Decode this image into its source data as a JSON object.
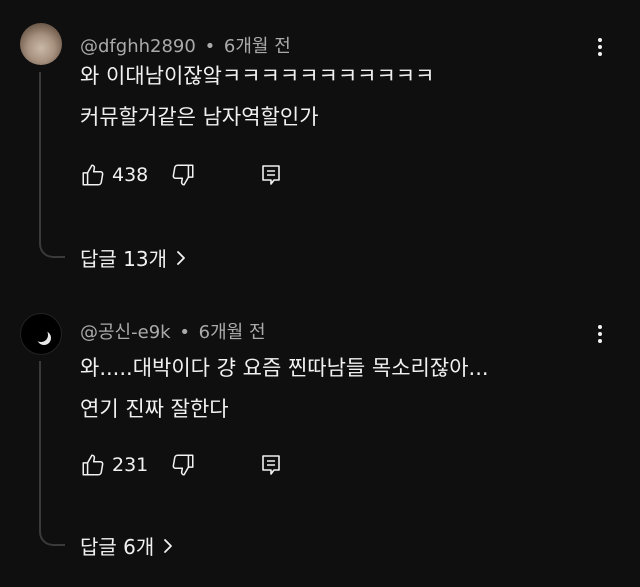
{
  "comments": [
    {
      "handle": "@dfghh2890",
      "separator": "•",
      "time": "6개월 전",
      "lines": [
        "와 이대남이잖앜ㅋㅋㅋㅋㅋㅋㅋㅋㅋㅋㅋ",
        "커뮤할거같은 남자역할인가"
      ],
      "likes": "438",
      "replies_label": "답글 13개"
    },
    {
      "handle": "@공신-e9k",
      "separator": "•",
      "time": "6개월 전",
      "lines": [
        "와.....대박이다 걍 요즘 찐따남들 목소리잖아...",
        "연기 진짜 잘한다"
      ],
      "likes": "231",
      "replies_label": "답글 6개"
    }
  ],
  "icons": {
    "like": "thumbs-up-icon",
    "dislike": "thumbs-down-icon",
    "reply": "reply-icon",
    "more": "more-vertical-icon",
    "expand": "chevron-right-icon"
  }
}
